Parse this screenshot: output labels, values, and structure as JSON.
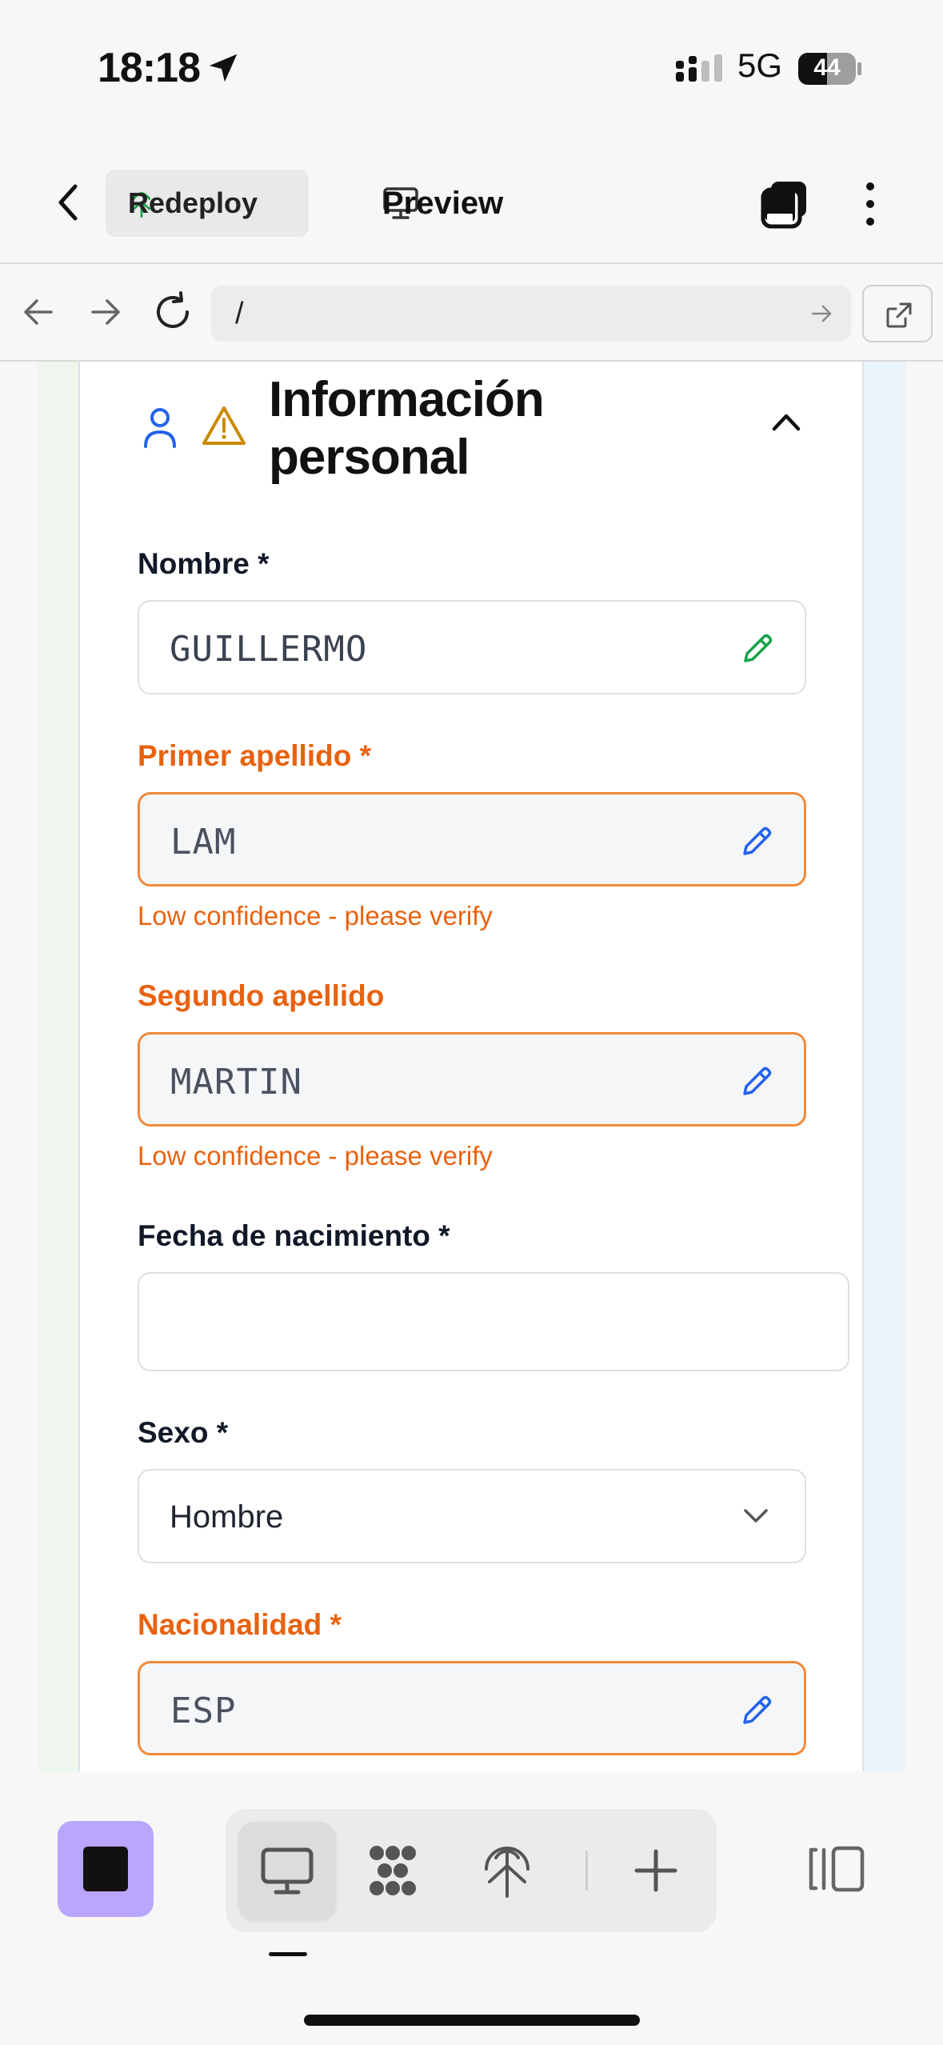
{
  "status_bar": {
    "time": "18:18",
    "network": "5G",
    "battery": "44"
  },
  "header": {
    "back_icon": "chevron-left-icon",
    "redeploy_label": "Redeploy",
    "preview_label": "Preview"
  },
  "url_bar": {
    "url": "/"
  },
  "section": {
    "title": "Información personal"
  },
  "form": {
    "nombre": {
      "label": "Nombre *",
      "value": "GUILLERMO"
    },
    "primer_apellido": {
      "label": "Primer apellido *",
      "value": "LAM",
      "hint": "Low confidence - please verify"
    },
    "segundo_apellido": {
      "label": "Segundo apellido",
      "value": "MARTIN",
      "hint": "Low confidence - please verify"
    },
    "fecha_nacimiento": {
      "label": "Fecha de nacimiento *",
      "value": ""
    },
    "sexo": {
      "label": "Sexo *",
      "value": "Hombre"
    },
    "nacionalidad": {
      "label": "Nacionalidad *",
      "value": "ESP"
    }
  },
  "colors": {
    "warning_orange": "#e8620f",
    "warning_border": "#f08a3c",
    "pencil_green": "#16a34a",
    "pencil_blue": "#2563eb",
    "stop_button": "#b8a6ff"
  },
  "icons": {
    "toolbar": [
      "desktop-icon",
      "graph-icon",
      "antenna-icon",
      "plus-icon",
      "panel-toggle-icon"
    ]
  }
}
